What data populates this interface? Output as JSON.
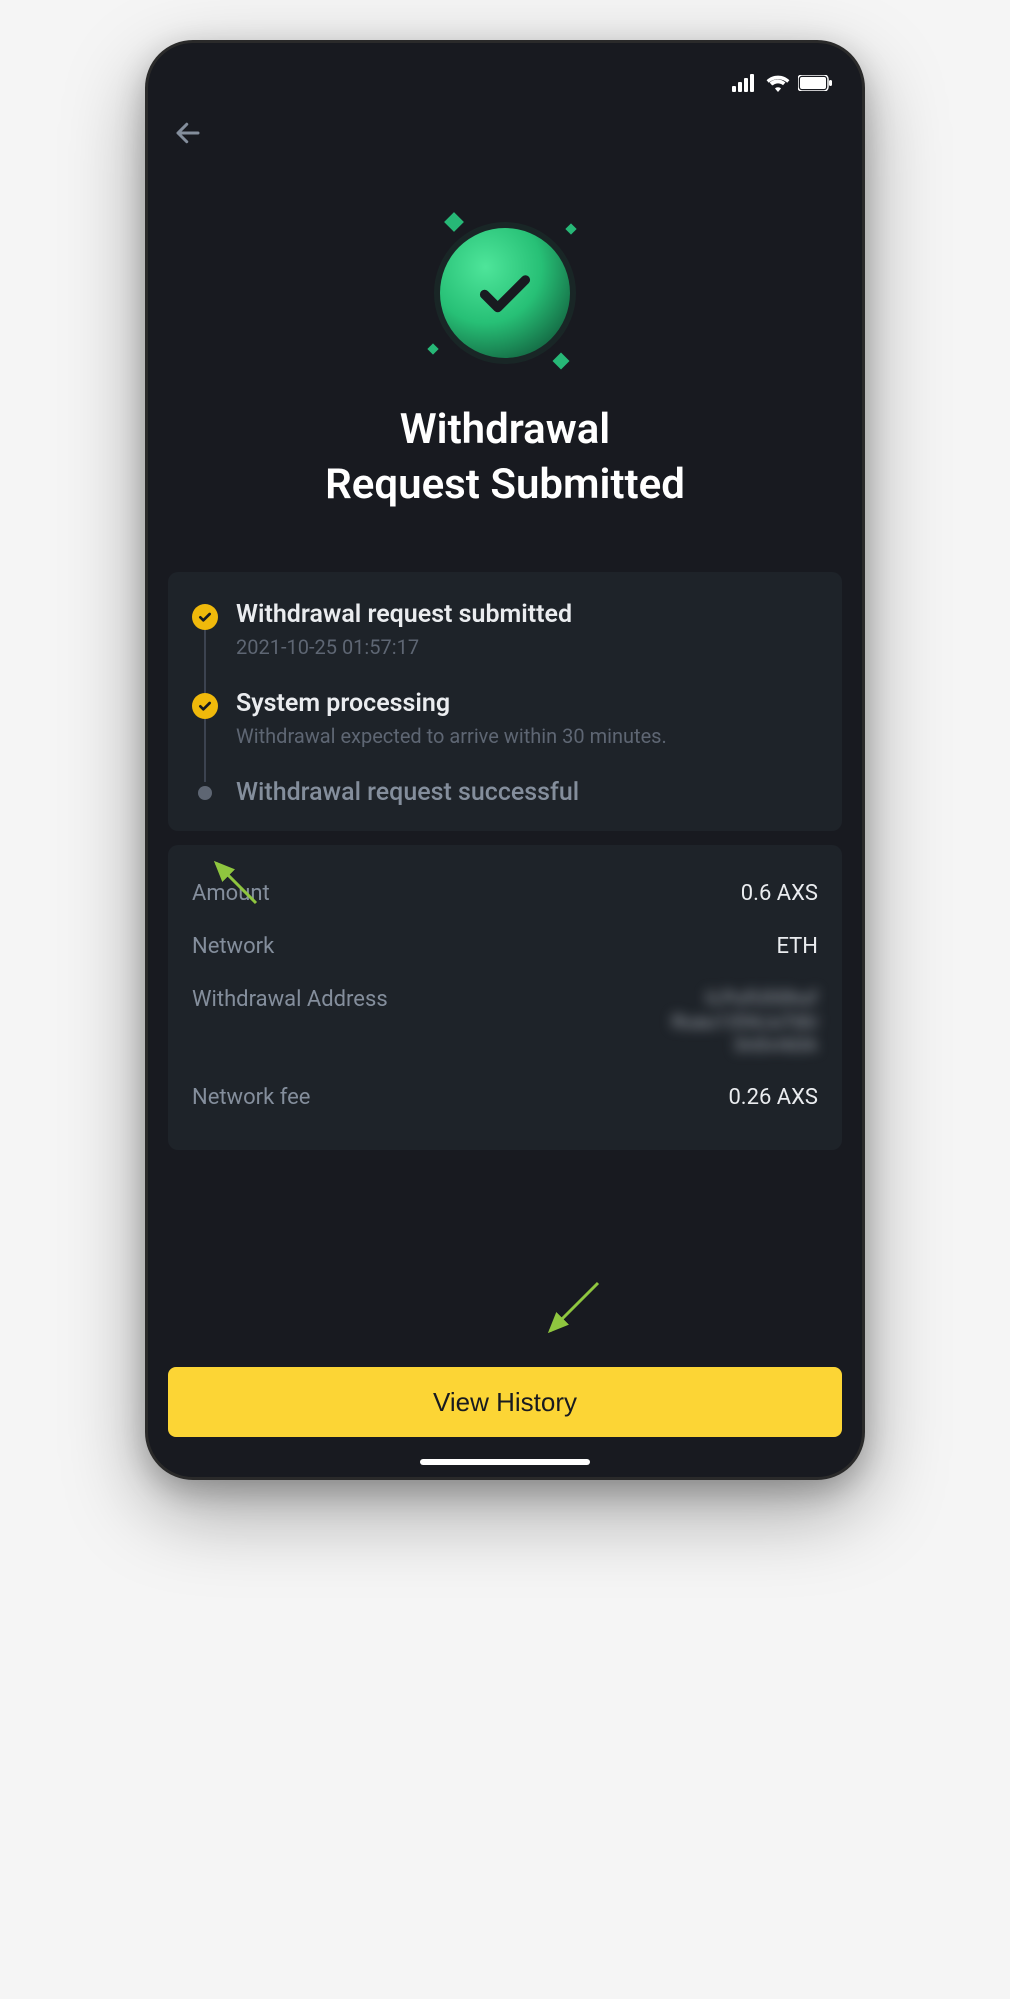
{
  "title": "Withdrawal\nRequest Submitted",
  "steps": [
    {
      "title": "Withdrawal request submitted",
      "subtitle": "2021-10-25 01:57:17",
      "done": true
    },
    {
      "title": "System processing",
      "subtitle": "Withdrawal expected to arrive within 30 minutes.",
      "done": true
    },
    {
      "title": "Withdrawal request successful",
      "subtitle": "",
      "done": false
    }
  ],
  "details": {
    "amount_label": "Amount",
    "amount_value": "0.6 AXS",
    "network_label": "Network",
    "network_value": "ETH",
    "address_label": "Withdrawal Address",
    "address_value": "ILPufUSShuf\nRuau1354JuTdU\n3n0vrk0A",
    "fee_label": "Network fee",
    "fee_value": "0.26 AXS"
  },
  "button_label": "View History"
}
